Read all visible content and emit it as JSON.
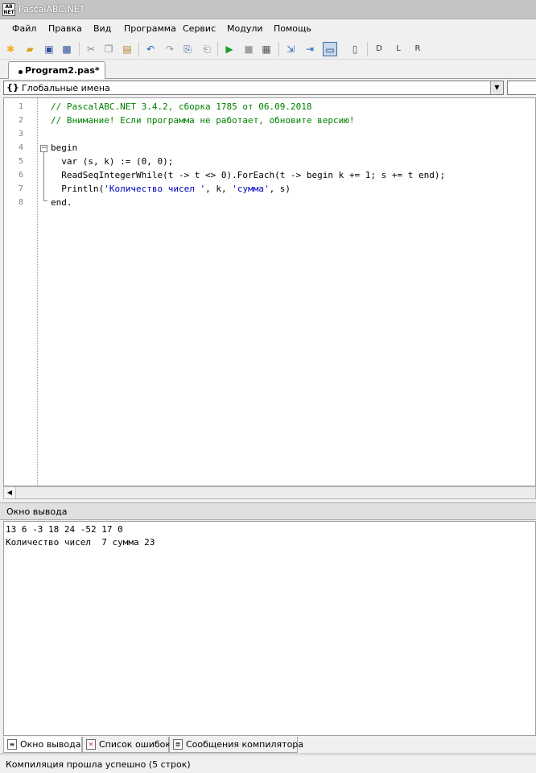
{
  "window": {
    "title": "PascalABC.NET",
    "icon_text": "AB NET"
  },
  "menu": [
    {
      "label": "Файл"
    },
    {
      "label": "Правка"
    },
    {
      "label": "Вид"
    },
    {
      "label": "Программа"
    },
    {
      "label": "Сервис"
    },
    {
      "label": "Модули"
    },
    {
      "label": "Помощь"
    }
  ],
  "toolbar": {
    "icons": [
      "new-file-icon",
      "open-folder-icon",
      "save-icon",
      "save-all-icon",
      "cut-icon",
      "copy-icon",
      "paste-icon",
      "undo-icon",
      "redo-icon",
      "find-icon",
      "replace-icon",
      "run-icon",
      "stop-icon",
      "build-icon",
      "debug-step-icon",
      "debug-into-icon",
      "console-icon",
      "output-window-icon",
      "module-d-icon",
      "module-l-icon",
      "module-r-icon"
    ]
  },
  "tabs": [
    {
      "label": "Program2.pas*"
    }
  ],
  "scope": {
    "icon": "{}",
    "text": "Глобальные имена"
  },
  "editor": {
    "line_numbers": [
      "1",
      "2",
      "3",
      "4",
      "5",
      "6",
      "7",
      "8"
    ]
  },
  "output": {
    "title": "Окно вывода",
    "lines": [
      "13 6 -3 18 24 -52 17 0",
      "Количество чисел  7 сумма 23"
    ]
  },
  "bottom_tabs": [
    {
      "label": "Окно вывода",
      "active": true
    },
    {
      "label": "Список ошибок",
      "active": false
    },
    {
      "label": "Сообщения компилятора",
      "active": false
    }
  ],
  "status": {
    "text": "Компиляция прошла успешно (5 строк)"
  },
  "code": {
    "l1": "// PascalABC.NET 3.4.2, сборка 1785 от 06.09.2018",
    "l2": "// Внимание! Если программа не работает, обновите версию!",
    "l4": "begin",
    "l5a": "  var (s, k) := (",
    "l5b": "0",
    "l5c": ", ",
    "l5d": "0",
    "l5e": ");",
    "l6a": "  ReadSeqIntegerWhile(t -> t <> ",
    "l6b": "0",
    "l6c": ").ForEach(t -> begin k += ",
    "l6d": "1",
    "l6e": "; s += t end);",
    "l7a": "  Println(",
    "l7b": "'Количество чисел '",
    "l7c": ", k, ",
    "l7d": "'сумма'",
    "l7e": ", s)",
    "l8": "end."
  }
}
